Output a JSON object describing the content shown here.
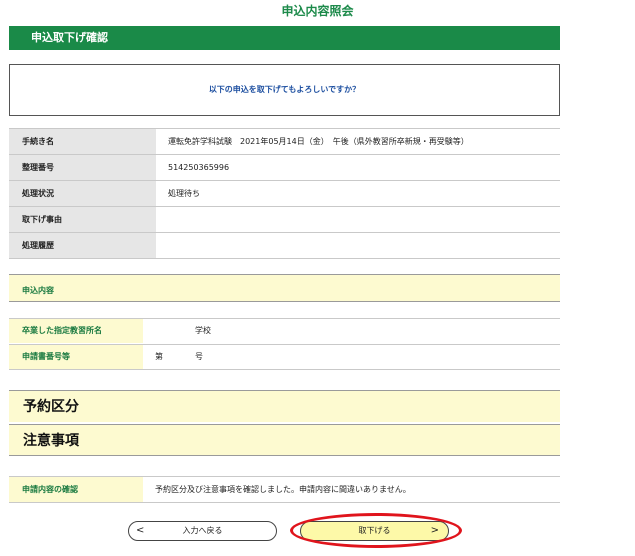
{
  "page": {
    "title": "申込内容照会"
  },
  "header": {
    "section_title": "申込取下げ確認"
  },
  "confirm": {
    "message": "以下の申込を取下げてもよろしいですか？"
  },
  "info": {
    "rows": [
      {
        "label": "手続き名",
        "value": "運転免許学科試験　2021年05月14日（金）　午後（県外教習所卒新規・再受験等）"
      },
      {
        "label": "整理番号",
        "value": "514250365996"
      },
      {
        "label": "処理状況",
        "value": "処理待ち"
      },
      {
        "label": "取下げ事由",
        "value": ""
      },
      {
        "label": "処理履歴",
        "value": ""
      }
    ]
  },
  "application": {
    "section_label": "申込内容",
    "school_label": "卒業した指定教習所名",
    "school_value": "　　　　　学校",
    "cert_label": "申請書番号等",
    "cert_value": "第　　　　号"
  },
  "reservation": {
    "label": "予約区分"
  },
  "notes": {
    "label": "注意事項"
  },
  "confirmation": {
    "label": "申請内容の確認",
    "value": "予約区分及び注意事項を確認しました。申請内容に間違いありません。"
  },
  "buttons": {
    "back_label": "入力へ戻る",
    "back_arrow": "<",
    "withdraw_label": "取下げる",
    "withdraw_arrow": ">"
  },
  "colors": {
    "header_green": "#1a8a48",
    "band_yellow": "#fdfad0",
    "highlight_red": "#e0141c"
  }
}
